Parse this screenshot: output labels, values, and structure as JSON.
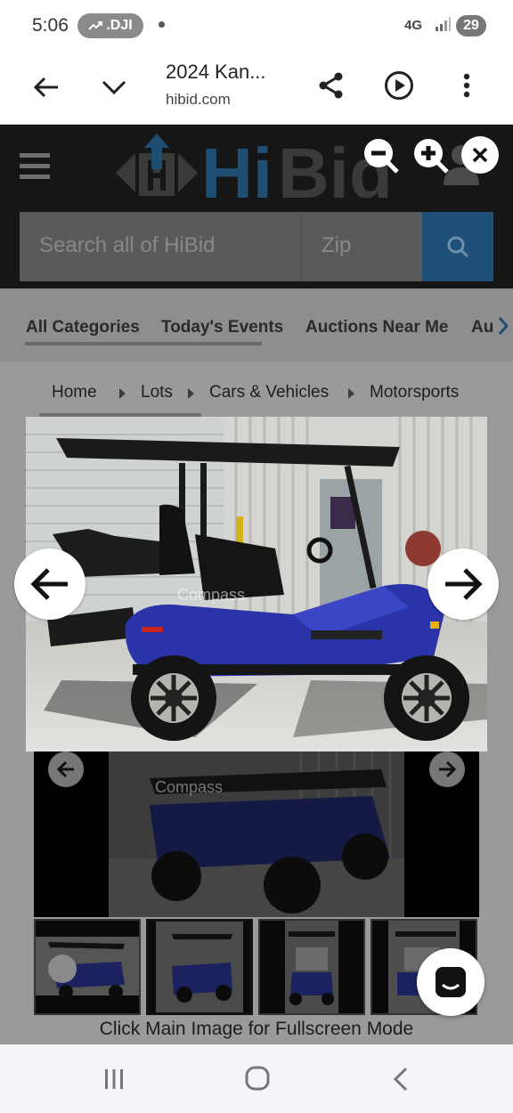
{
  "status_bar": {
    "time": "5:06",
    "notification_pill": ".DJI",
    "network": "4G",
    "battery": "29"
  },
  "browser": {
    "page_title": "2024 Kan...",
    "url": "hibid.com",
    "back_icon": "arrow-left-icon",
    "expand_icon": "chevron-down-icon",
    "share_icon": "share-icon",
    "listen_icon": "play-icon",
    "menu_icon": "more-vert-icon"
  },
  "site": {
    "logo_text": "HiBid",
    "search_placeholder": "Search all of HiBid",
    "zip_placeholder": "Zip",
    "search_icon": "search-icon",
    "categories": [
      "All Categories",
      "Today's Events",
      "Auctions Near Me",
      "Au"
    ],
    "breadcrumb": [
      "Home",
      "Lots",
      "Cars & Vehicles",
      "Motorsports"
    ],
    "gallery_hint": "Click Main Image for Fullscreen Mode",
    "watermark": "Compass"
  },
  "image_viewer": {
    "zoom_out_icon": "zoom-out-icon",
    "zoom_in_icon": "zoom-in-icon",
    "close_icon": "close-icon",
    "prev_icon": "arrow-left-icon",
    "next_icon": "arrow-right-icon"
  },
  "colors": {
    "header_bg": "#161616",
    "logo_blue": "#1f4e73",
    "search_btn": "#1e4f78",
    "cart_blue": "#2a33a8"
  },
  "android_nav": {
    "recents_icon": "recents-icon",
    "home_icon": "home-icon",
    "back_icon": "back-icon"
  }
}
